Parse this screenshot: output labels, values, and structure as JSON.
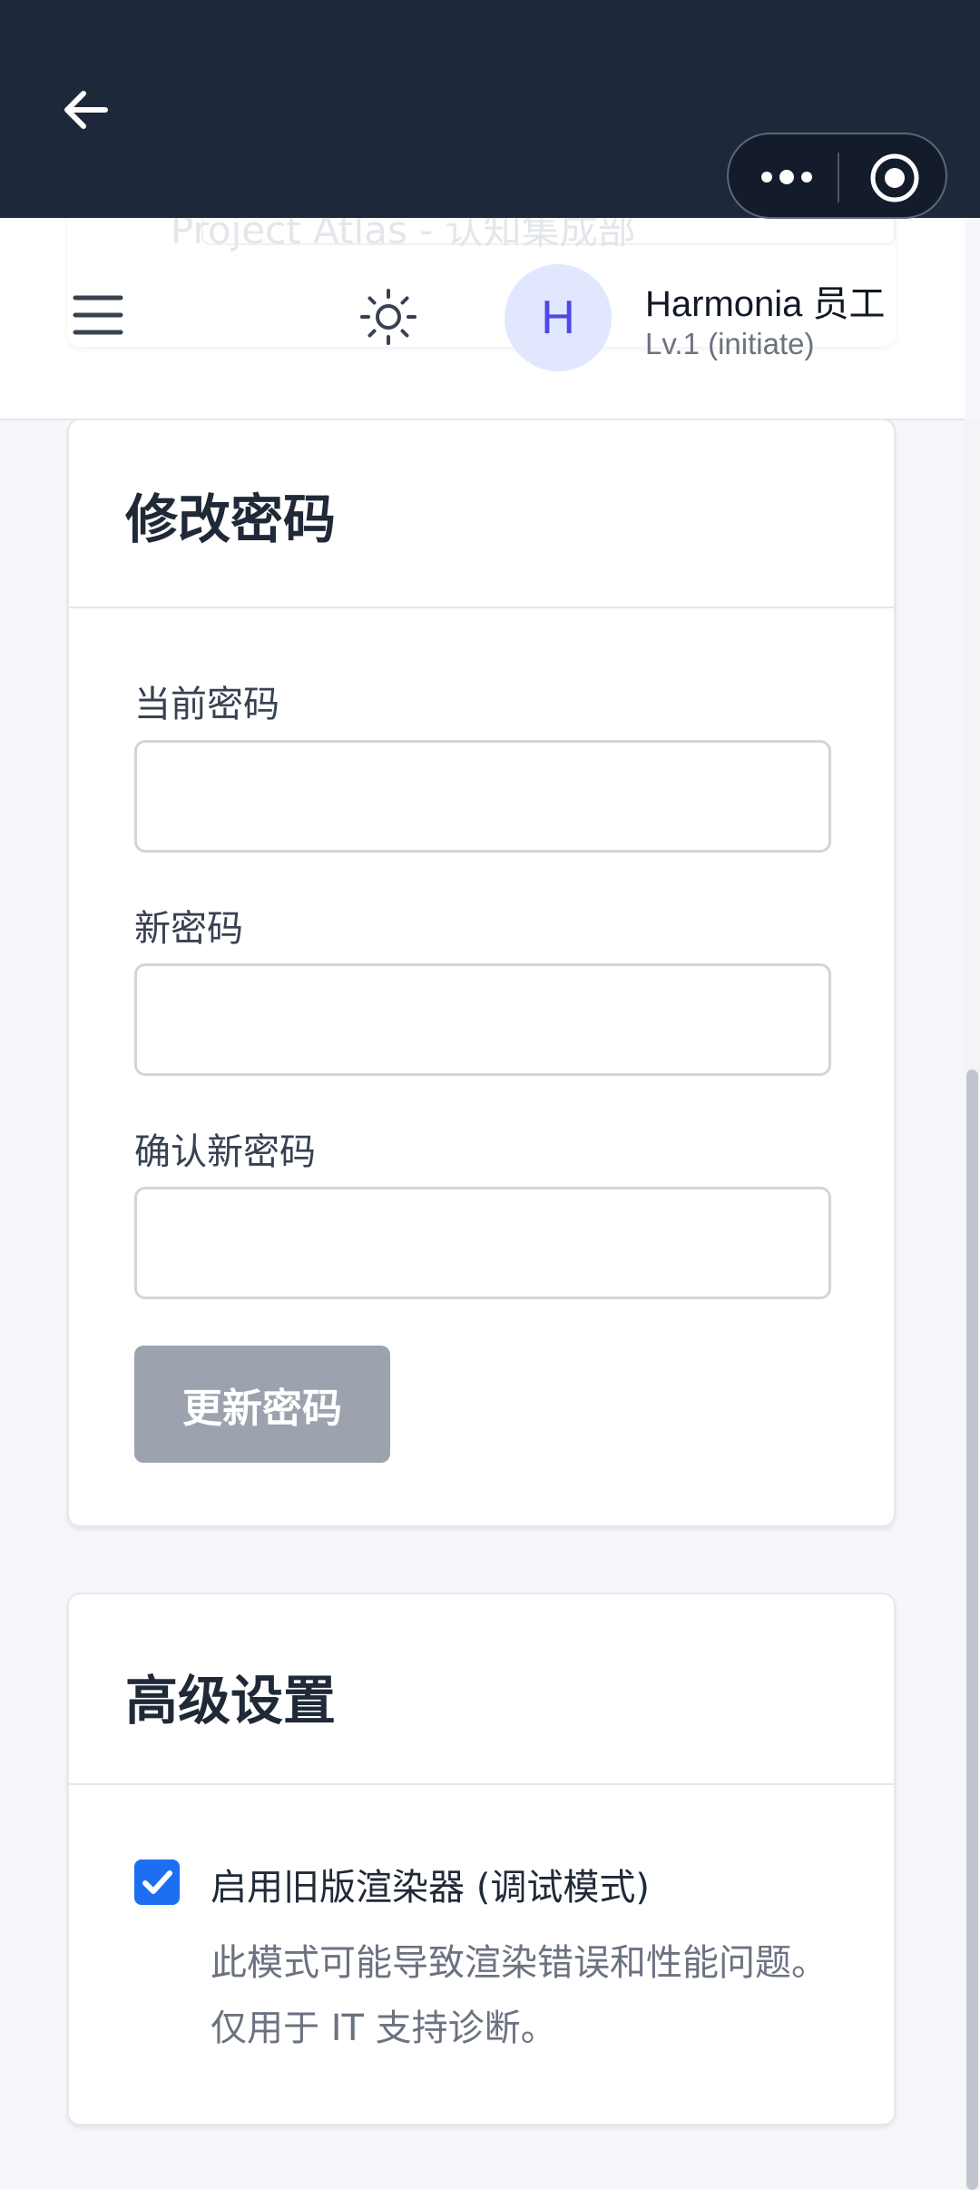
{
  "header": {
    "ghost_placeholder": "Project Atlas - 认知集成部",
    "user": {
      "avatar_letter": "H",
      "name": "Harmonia 员工",
      "level": "Lv.1 (initiate)"
    }
  },
  "password_card": {
    "title": "修改密码",
    "fields": [
      {
        "label": "当前密码",
        "value": ""
      },
      {
        "label": "新密码",
        "value": ""
      },
      {
        "label": "确认新密码",
        "value": ""
      }
    ],
    "submit_label": "更新密码"
  },
  "advanced_card": {
    "title": "高级设置",
    "legacy_renderer": {
      "checked": true,
      "label": "启用旧版渲染器 (调试模式)",
      "description": "此模式可能导致渲染错误和性能问题。仅用于 IT 支持诊断。"
    }
  },
  "icons": {
    "back": "arrow-left-icon",
    "more": "more-dots-icon",
    "close_target": "target-icon",
    "menu": "hamburger-icon",
    "theme": "sun-icon"
  },
  "colors": {
    "topbar": "#1e283b",
    "accent": "#1d6ff2",
    "avatar_bg": "#e0e7ff",
    "avatar_fg": "#4f46e5",
    "disabled_button": "#9ca3af"
  }
}
